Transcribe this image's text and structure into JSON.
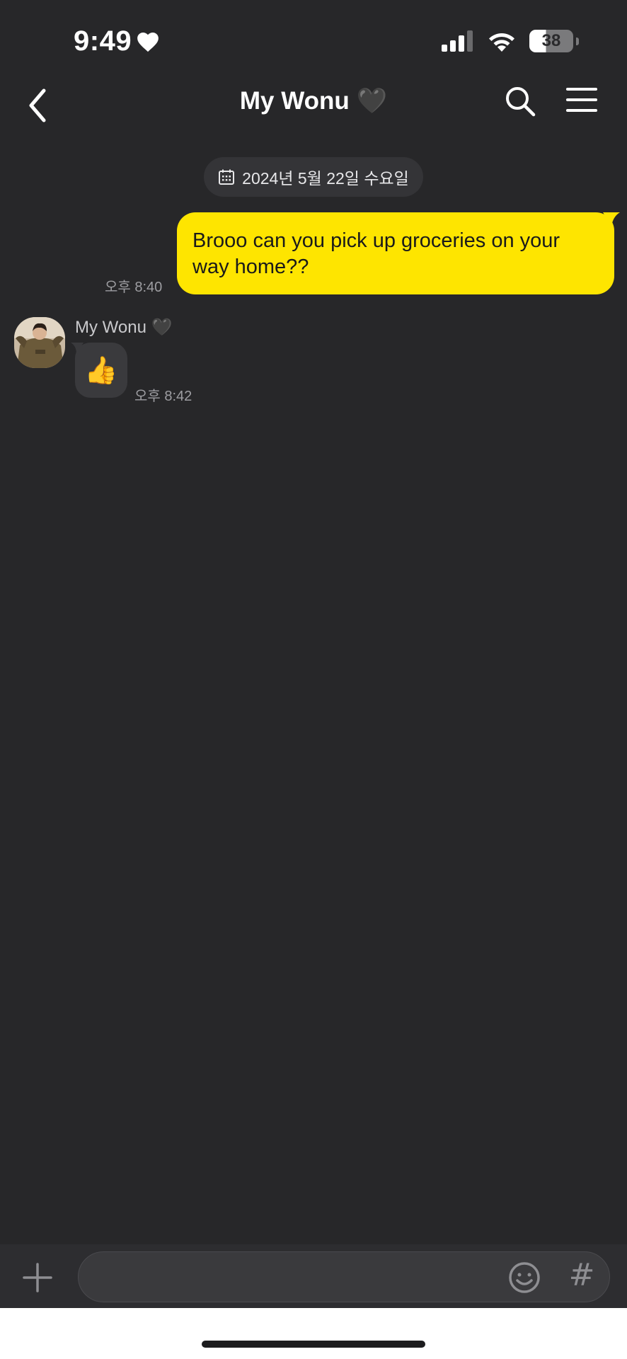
{
  "status_bar": {
    "time": "9:49",
    "battery_level": "38"
  },
  "header": {
    "title": "My Wonu 🖤"
  },
  "date_chip": {
    "label": "2024년 5월 22일 수요일"
  },
  "messages": [
    {
      "direction": "sent",
      "text": "Brooo can you pick up groceries on your way home??",
      "time": "오후 8:40"
    },
    {
      "direction": "received",
      "sender": "My Wonu 🖤",
      "text": "👍",
      "time": "오후 8:42"
    }
  ],
  "input": {
    "placeholder": "",
    "hashtag_label": "#"
  },
  "colors": {
    "background": "#272729",
    "sent_bubble": "#fee500",
    "received_bubble": "#3a3a3d",
    "input_bar": "#2d2d30"
  },
  "icons": {
    "back": "chevron-left-icon",
    "search": "search-icon",
    "menu": "hamburger-menu-icon",
    "calendar": "calendar-icon",
    "attach": "plus-icon",
    "emoji": "smiley-icon",
    "heart": "heart-icon"
  }
}
